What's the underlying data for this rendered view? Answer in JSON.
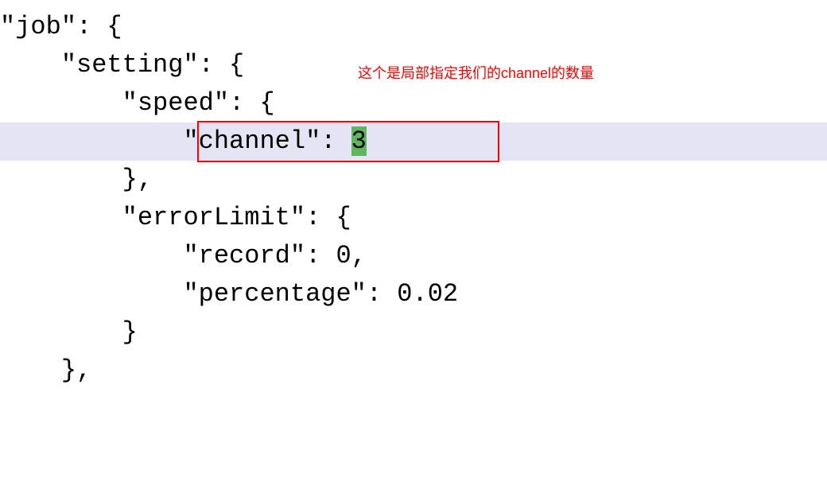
{
  "code": {
    "line1": "\"job\": {",
    "line2": "    \"setting\": {",
    "line3": "        \"speed\": {",
    "line4_key": "            \"channel\": ",
    "line4_value": "3",
    "line5": "        },",
    "line6": "        \"errorLimit\": {",
    "line7": "            \"record\": 0,",
    "line8": "            \"percentage\": 0.02",
    "line9": "        }",
    "line10": "    },"
  },
  "annotation": {
    "text": "这个是局部指定我们的channel的数量"
  }
}
